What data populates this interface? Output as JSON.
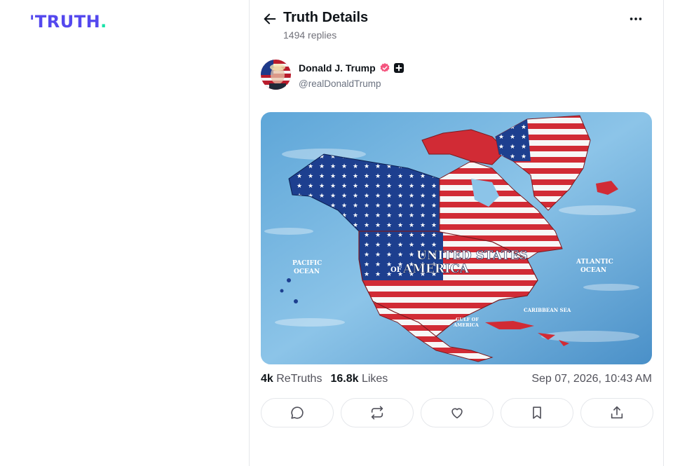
{
  "brand": {
    "logo_text": "TRUTH",
    "logo_dot": ".",
    "accent": "#5448ee",
    "dot_color": "#17e3a8"
  },
  "header": {
    "title": "Truth Details",
    "subtitle": "1494 replies"
  },
  "post": {
    "author": {
      "name": "Donald J. Trump",
      "handle": "@realDonaldTrump",
      "verified_color": "#f4547e"
    },
    "image": {
      "headline_line1": "UNITED STATES",
      "headline_of": "OF",
      "headline_line2": "AMERICA",
      "labels": {
        "pacific": [
          "PACIFIC",
          "OCEAN"
        ],
        "atlantic": [
          "ATLANTIC",
          "OCEAN"
        ],
        "caribbean": "CARIBBEAN SEA",
        "gulf": [
          "GULF OF",
          "AMERICA"
        ]
      }
    },
    "stats": {
      "retruths_count": "4k",
      "retruths_label": "ReTruths",
      "likes_count": "16.8k",
      "likes_label": "Likes"
    },
    "timestamp": "Sep 07, 2026, 10:43 AM"
  },
  "actions": [
    {
      "name": "reply",
      "icon": "reply-icon"
    },
    {
      "name": "retruth",
      "icon": "retruth-icon"
    },
    {
      "name": "like",
      "icon": "heart-icon"
    },
    {
      "name": "bookmark",
      "icon": "bookmark-icon"
    },
    {
      "name": "share",
      "icon": "share-icon"
    }
  ]
}
